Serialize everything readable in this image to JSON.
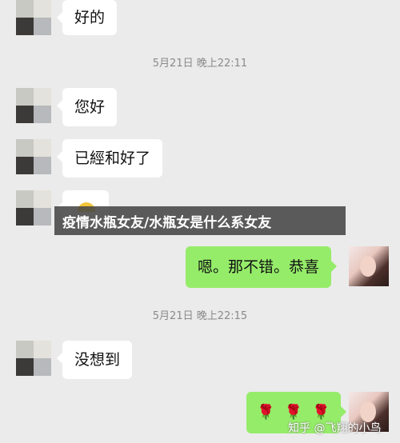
{
  "messages": {
    "m1": "好的",
    "m2": "您好",
    "m3": "已經和好了",
    "m4": "嗯。那不错。恭喜",
    "m5": "没想到",
    "m6": [
      "🌹",
      "🌹",
      "🌹"
    ]
  },
  "timestamps": {
    "t1": "5月21日 晚上22:11",
    "t2": "5月21日 晚上22:15"
  },
  "banner": {
    "title": "疫情水瓶女友/水瓶女是什么系女友"
  },
  "watermark": "知乎 @飞翔的小鸟",
  "colors": {
    "background": "#ebebeb",
    "incoming_bubble": "#ffffff",
    "outgoing_bubble": "#95ec69"
  }
}
